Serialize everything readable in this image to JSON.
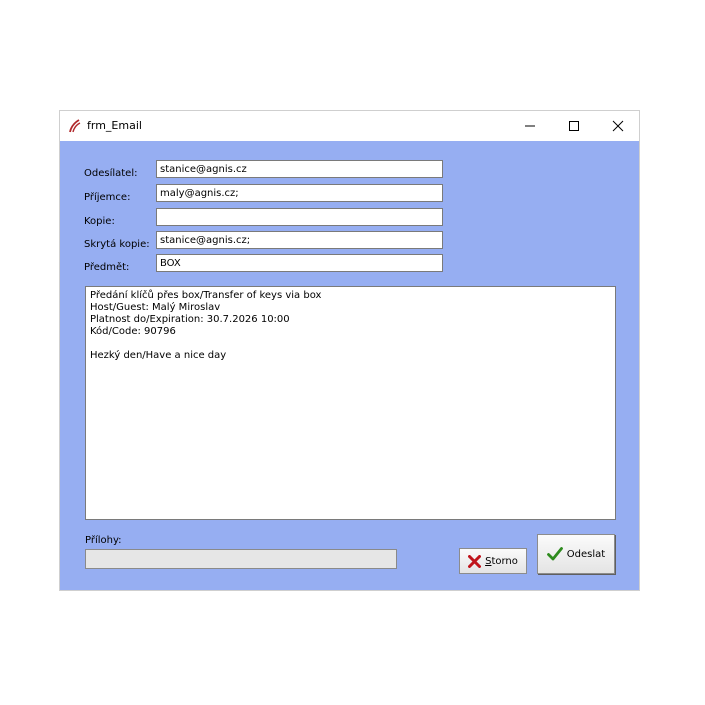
{
  "window": {
    "title": "frm_Email",
    "controls": {
      "minimize": "—",
      "maximize": "☐",
      "close": "✕"
    }
  },
  "form": {
    "sender": {
      "label": "Odesílatel:",
      "value": "stanice@agnis.cz"
    },
    "recipient": {
      "label": "Příjemce:",
      "value": "maly@agnis.cz;"
    },
    "cc": {
      "label": "Kopie:",
      "value": ""
    },
    "bcc": {
      "label": "Skrytá kopie:",
      "value": "stanice@agnis.cz;"
    },
    "subject": {
      "label": "Předmět:",
      "value": "BOX"
    }
  },
  "message": {
    "lines": [
      "Předání klíčů přes box/Transfer of keys via box",
      "Host/Guest: Malý Miroslav",
      "Platnost do/Expiration: 30.7.2026 10:00",
      "Kód/Code: 90796",
      "",
      "Hezký den/Have a nice day"
    ]
  },
  "attachments": {
    "label": "Přílohy:",
    "value": ""
  },
  "buttons": {
    "storno": {
      "mnemonic": "S",
      "rest": "torno",
      "icon": "red-x-icon"
    },
    "send": {
      "label": "Odeslat",
      "icon": "green-check-icon"
    }
  },
  "colors": {
    "client_bg": "#96aef2",
    "storno_icon": "#c0141c",
    "send_icon": "#2e8b1e"
  }
}
